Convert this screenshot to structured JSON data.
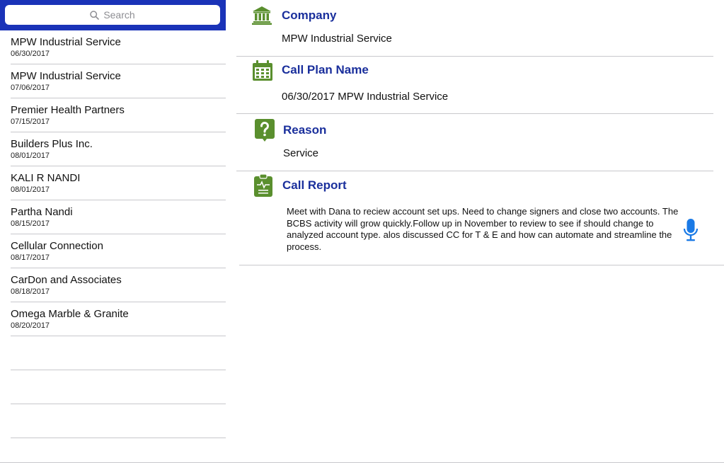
{
  "search": {
    "placeholder": "Search"
  },
  "list": {
    "items": [
      {
        "name": "MPW Industrial Service",
        "date": "06/30/2017"
      },
      {
        "name": "MPW Industrial Service",
        "date": "07/06/2017"
      },
      {
        "name": "Premier Health Partners",
        "date": "07/15/2017"
      },
      {
        "name": "Builders Plus Inc.",
        "date": "08/01/2017"
      },
      {
        "name": "KALI R NANDI",
        "date": "08/01/2017"
      },
      {
        "name": "Partha Nandi",
        "date": "08/15/2017"
      },
      {
        "name": "Cellular Connection",
        "date": "08/17/2017"
      },
      {
        "name": "CarDon and Associates",
        "date": "08/18/2017"
      },
      {
        "name": "Omega Marble & Granite",
        "date": "08/20/2017"
      }
    ]
  },
  "detail": {
    "company": {
      "title": "Company",
      "value": "MPW Industrial Service"
    },
    "plan": {
      "title": "Call Plan Name",
      "value": "06/30/2017 MPW Industrial Service"
    },
    "reason": {
      "title": "Reason",
      "value": "Service"
    },
    "report": {
      "title": "Call Report",
      "text": "Meet with Dana to reciew account set ups. Need to change signers and close two accounts. The BCBS activity will grow quickly.Follow up in November to review to see if should change to analyzed account type. alos discussed CC for T & E and how can automate and streamline the process."
    }
  },
  "colors": {
    "search_bar": "#1a33b8",
    "section_title": "#1a2f9c",
    "icon_green": "#5a8f2e",
    "mic_blue": "#1a7ae6"
  },
  "icons": {
    "search": "search-icon",
    "company": "bank-icon",
    "plan": "calendar-icon",
    "reason": "question-icon",
    "report": "clipboard-icon",
    "dictation": "microphone-icon"
  }
}
